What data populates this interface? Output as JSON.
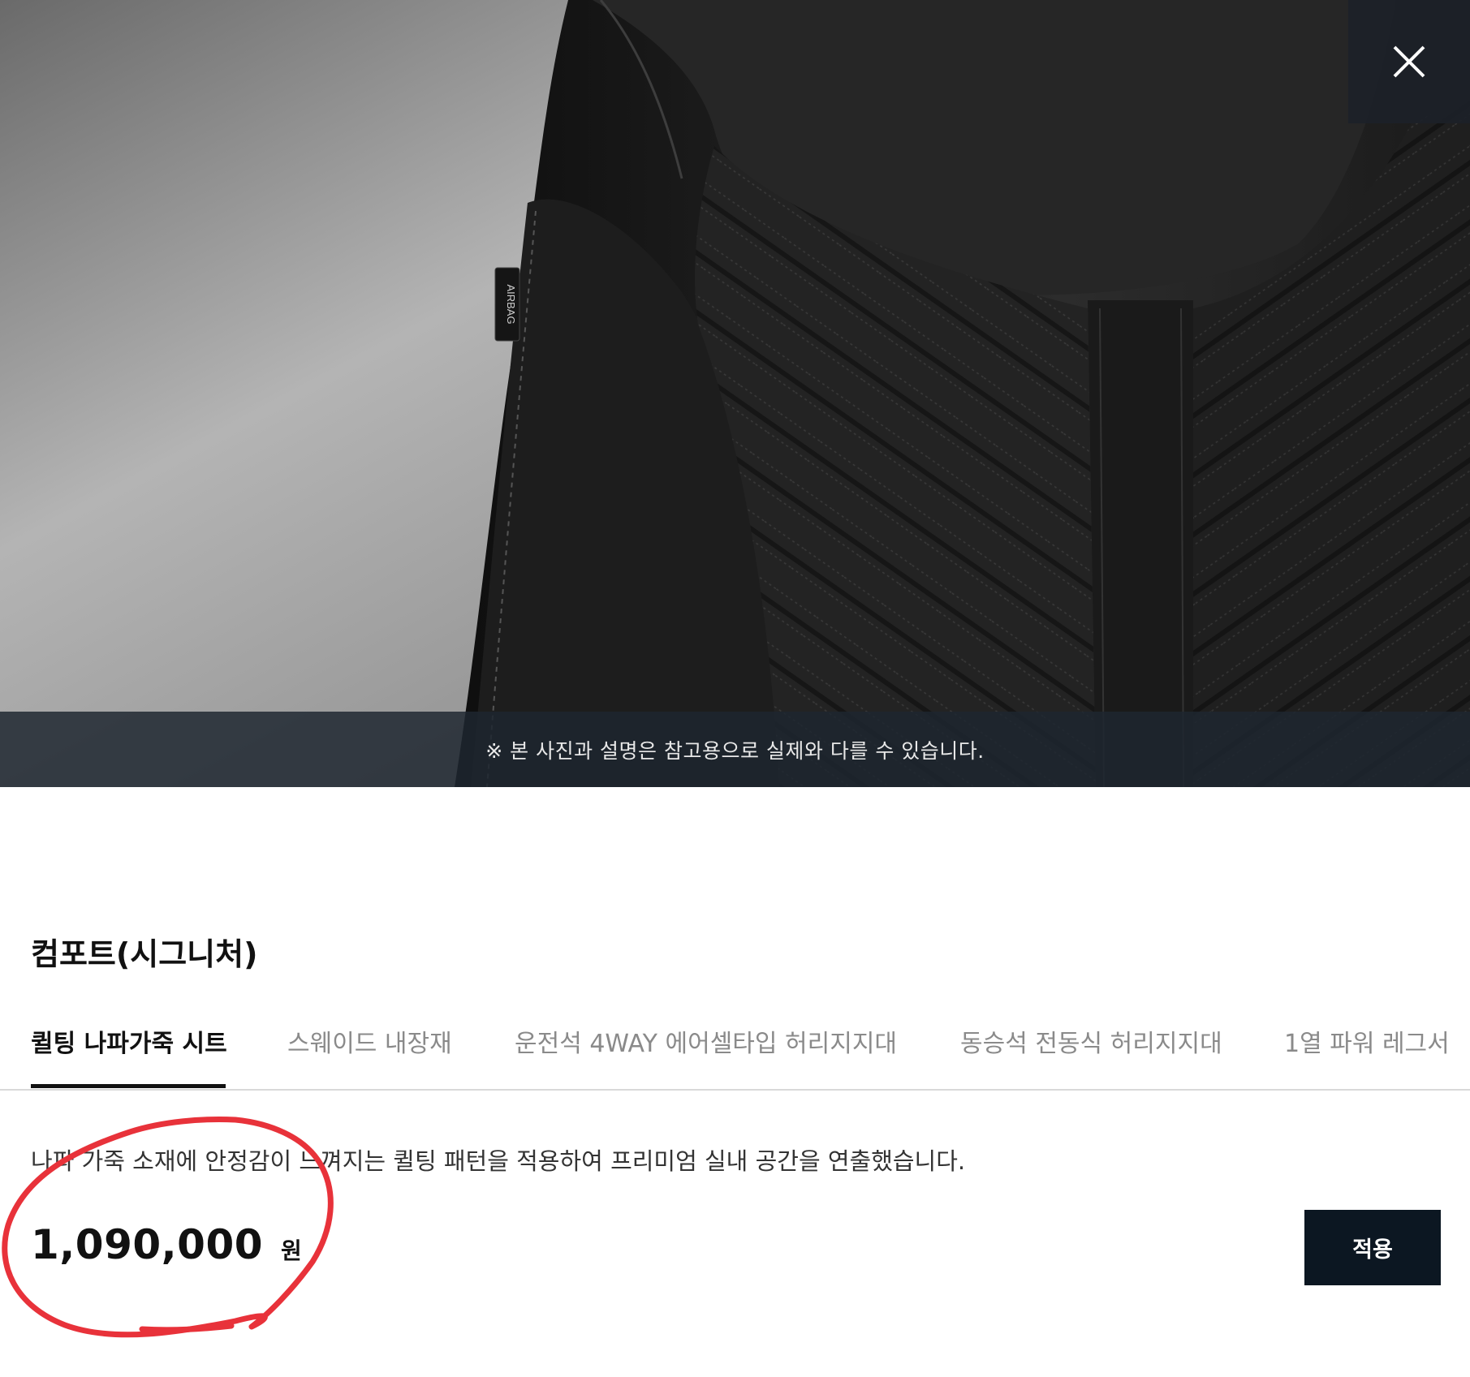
{
  "hero": {
    "seat_label": "AIRBAG",
    "caption": "※ 본 사진과 설명은 참고용으로 실제와 다를 수 있습니다.",
    "close_icon": "close-icon"
  },
  "option": {
    "title": "컴포트(시그니처)",
    "tabs": [
      {
        "label": "퀼팅 나파가죽 시트",
        "active": true
      },
      {
        "label": "스웨이드 내장재",
        "active": false
      },
      {
        "label": "운전석 4WAY 에어셀타입 허리지지대",
        "active": false
      },
      {
        "label": "동승석 전동식 허리지지대",
        "active": false
      },
      {
        "label": "1열 파워 레그서",
        "active": false
      }
    ],
    "description": "나파 가죽 소재에 안정감이 느껴지는 퀼팅 패턴을 적용하여 프리미엄 실내 공간을 연출했습니다.",
    "price": "1,090,000",
    "price_unit": "원",
    "apply_label": "적용"
  },
  "colors": {
    "accent_dark": "#0c1722",
    "annotation_red": "#e8323a"
  }
}
